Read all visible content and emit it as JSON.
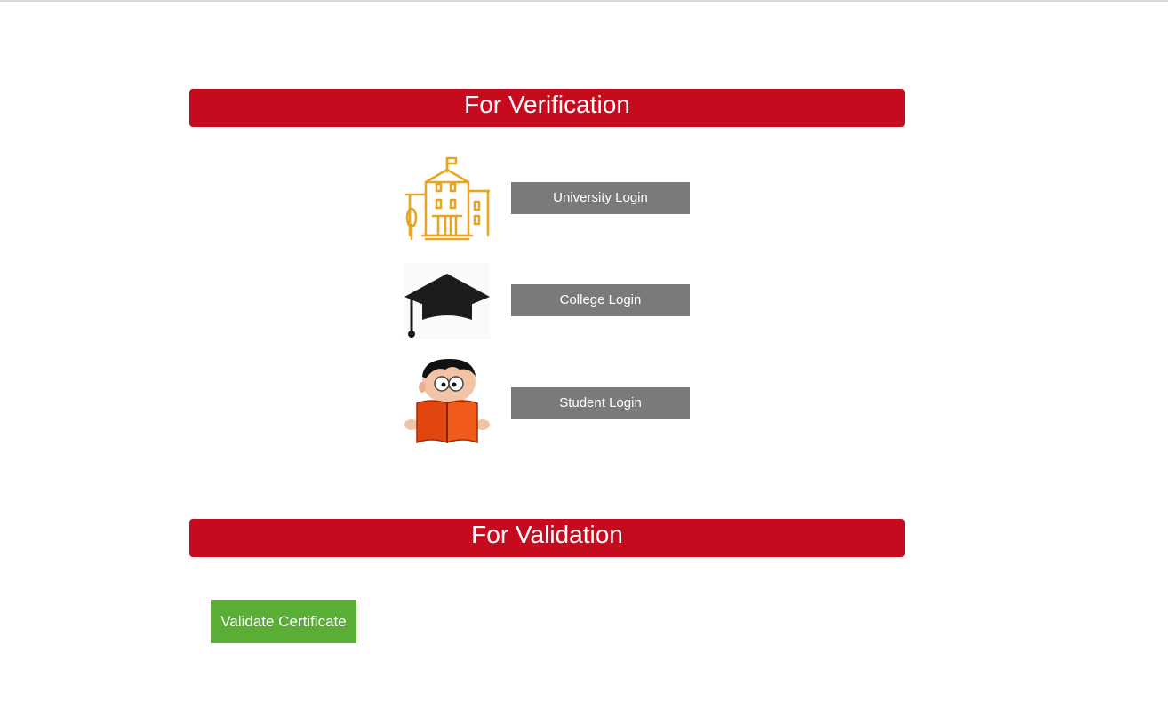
{
  "sections": {
    "verification_title": "For Verification",
    "validation_title": "For Validation"
  },
  "logins": {
    "university": {
      "label": "University Login",
      "icon": "university-building-icon"
    },
    "college": {
      "label": "College Login",
      "icon": "graduation-cap-icon"
    },
    "student": {
      "label": "Student Login",
      "icon": "student-reading-icon"
    }
  },
  "validation": {
    "button_label": "Validate Certificate"
  },
  "colors": {
    "banner": "#c60b1e",
    "login_button": "#7a7a7a",
    "validate_button": "#5aad35",
    "university_icon": "#e8a524"
  }
}
